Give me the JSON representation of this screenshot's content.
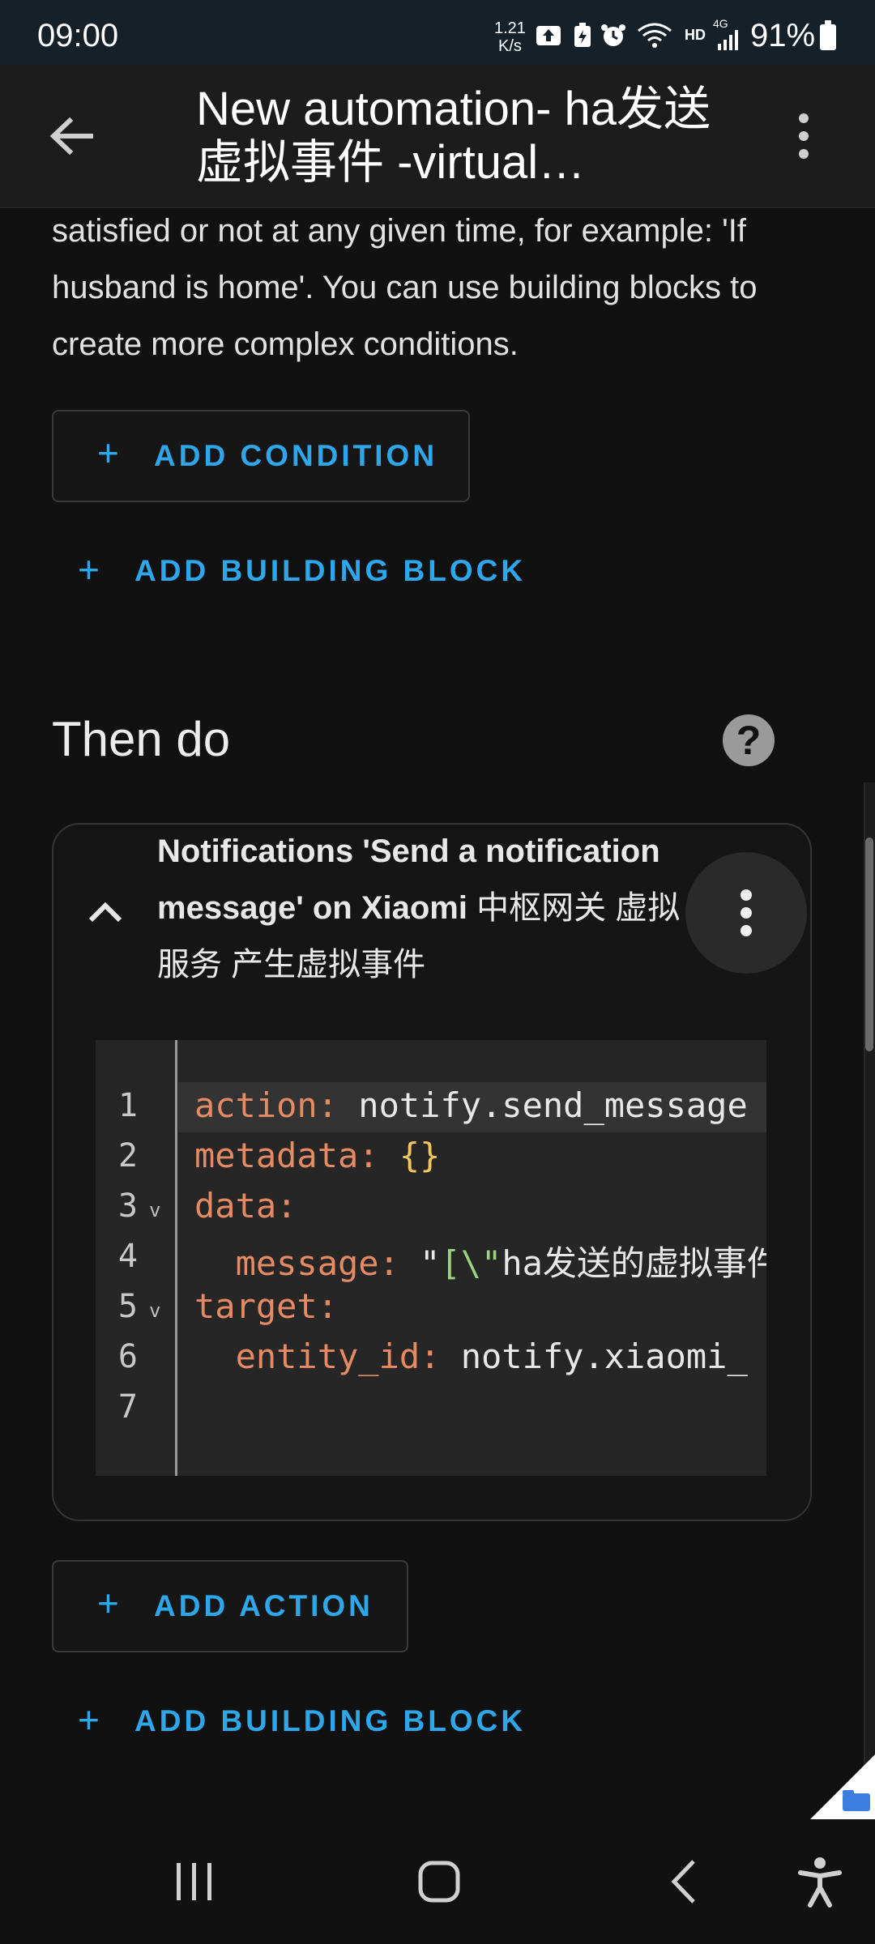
{
  "status_bar": {
    "time": "09:00",
    "net_speed_value": "1.21",
    "net_speed_unit": "K/s",
    "hd_label": "HD",
    "network_label": "4G",
    "battery": "91%",
    "icons": [
      "upload-icon",
      "battery-saver-icon",
      "alarm-icon",
      "wifi-icon",
      "signal-icon",
      "battery-icon"
    ]
  },
  "app_bar": {
    "title": "New automation- ha发送虚拟事件 -virtual…"
  },
  "conditions": {
    "description": "satisfied or not at any given time, for example: 'If husband is home'. You can use building blocks to create more complex conditions.",
    "add_condition_label": "ADD CONDITION",
    "add_building_block_label": "ADD BUILDING BLOCK"
  },
  "actions": {
    "heading": "Then do",
    "card": {
      "title_part1": "Notifications 'Send a notification message' on Xiaomi",
      "title_part2": " 中枢网关 虚拟服务 产生虚拟事件"
    },
    "code": {
      "line_numbers": [
        "1",
        "2",
        "3",
        "4",
        "5",
        "6",
        "7"
      ],
      "fold_marker": "v",
      "l1_key": "action:",
      "l1_val": " notify.send_message",
      "l2_key": "metadata:",
      "l2_val": " {}",
      "l3_key": "data:",
      "l4_key": "  message:",
      "l4_q": " \"",
      "l4_br": "[\\\"",
      "l4_text": "ha发送的虚拟事件",
      "l5_key": "target:",
      "l6_key": "  entity_id:",
      "l6_val": " notify.xiaomi_"
    },
    "add_action_label": "ADD ACTION",
    "add_building_block_label": "ADD BUILDING BLOCK"
  },
  "colors": {
    "accent": "#2ea6ea",
    "yaml_key": "#e68a63",
    "yaml_string": "#9bd27c",
    "yaml_punct": "#f2c75c"
  }
}
